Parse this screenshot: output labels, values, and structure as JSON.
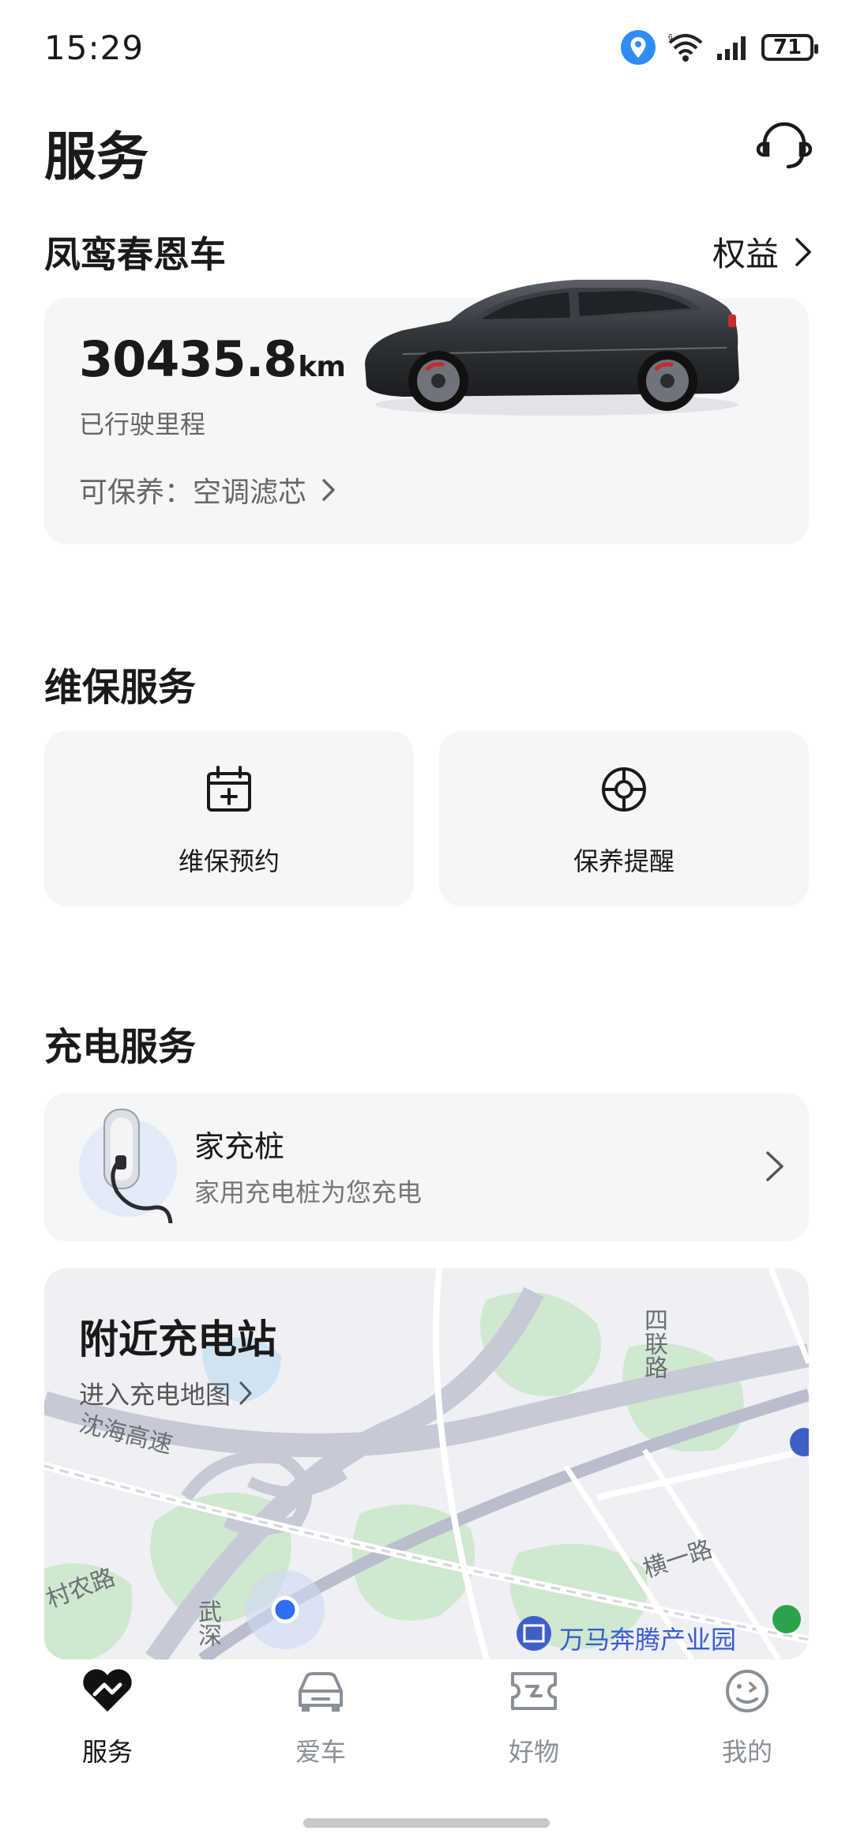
{
  "status": {
    "time": "15:29",
    "battery": "71"
  },
  "header": {
    "title": "服务",
    "headset_icon": "headset-icon"
  },
  "car": {
    "name": "凤鸾春恩车",
    "benefits_label": "权益",
    "mileage_value": "30435.8",
    "mileage_unit": "km",
    "mileage_label": "已行驶里程",
    "maintenance_text": "可保养：空调滤芯"
  },
  "maintenance_section": {
    "title": "维保服务",
    "items": [
      {
        "label": "维保预约",
        "icon": "calendar-plus-icon"
      },
      {
        "label": "保养提醒",
        "icon": "steering-wheel-icon"
      }
    ]
  },
  "charging_section": {
    "title": "充电服务",
    "home_charger": {
      "title": "家充桩",
      "subtitle": "家用充电桩为您充电"
    },
    "nearby": {
      "title": "附近充电站",
      "link": "进入充电地图",
      "map_labels": {
        "road1": "沈海高速",
        "road2": "四联路",
        "road3": "横一路",
        "road4": "村农路",
        "road5": "武深",
        "poi": "万马奔腾产业园"
      }
    }
  },
  "tabbar": {
    "tabs": [
      {
        "label": "服务",
        "active": true,
        "icon": "heart-service-icon"
      },
      {
        "label": "爱车",
        "active": false,
        "icon": "car-icon"
      },
      {
        "label": "好物",
        "active": false,
        "icon": "ticket-icon"
      },
      {
        "label": "我的",
        "active": false,
        "icon": "face-icon"
      }
    ],
    "active_color": "#111111",
    "inactive_color": "#8a8f96"
  }
}
